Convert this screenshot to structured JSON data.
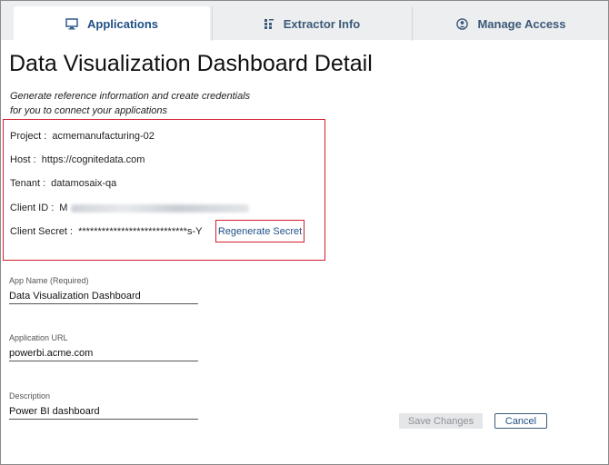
{
  "tabs": [
    {
      "label": "Applications",
      "icon": "monitor-icon",
      "active": true
    },
    {
      "label": "Extractor Info",
      "icon": "extractor-icon",
      "active": false
    },
    {
      "label": "Manage Access",
      "icon": "user-circle-icon",
      "active": false
    }
  ],
  "page": {
    "title": "Data Visualization Dashboard Detail",
    "intro_line1": "Generate reference information and create credentials",
    "intro_line2": "for you to connect your applications"
  },
  "credentials": {
    "project_label": "Project :",
    "project_value": "acmemanufacturing-02",
    "host_label": "Host :",
    "host_value": "https://cognitedata.com",
    "tenant_label": "Tenant :",
    "tenant_value": "datamosaix-qa",
    "client_id_label": "Client ID :",
    "client_id_prefix": "M",
    "client_secret_label": "Client Secret :",
    "client_secret_value": "****************************s-Y",
    "regenerate_label": "Regenerate Secret"
  },
  "form": {
    "app_name_label": "App Name (Required)",
    "app_name_value": "Data Visualization Dashboard",
    "app_url_label": "Application URL",
    "app_url_value": "powerbi.acme.com",
    "description_label": "Description",
    "description_value": "Power BI dashboard"
  },
  "actions": {
    "save_label": "Save Changes",
    "save_enabled": false,
    "cancel_label": "Cancel"
  },
  "colors": {
    "accent": "#1f4f86",
    "highlight_border": "#d11e2a",
    "tabbar_bg": "#eceeef"
  }
}
